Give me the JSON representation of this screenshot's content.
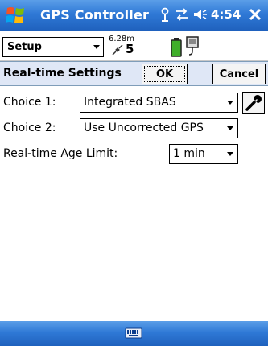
{
  "titlebar": {
    "title": "GPS Controller",
    "clock": "4:54"
  },
  "toolbar": {
    "setup_label": "Setup",
    "distance": "6.28m",
    "satellites": "5"
  },
  "header": {
    "title": "Real-time Settings",
    "ok_label": "OK",
    "cancel_label": "Cancel"
  },
  "form": {
    "choice1_label": "Choice 1:",
    "choice1_value": "Integrated SBAS",
    "choice2_label": "Choice 2:",
    "choice2_value": "Use Uncorrected GPS",
    "age_label": "Real-time Age Limit:",
    "age_value": "1 min"
  },
  "colors": {
    "titlebar": "#2f79d6",
    "header_bg": "#dfe7f6"
  }
}
